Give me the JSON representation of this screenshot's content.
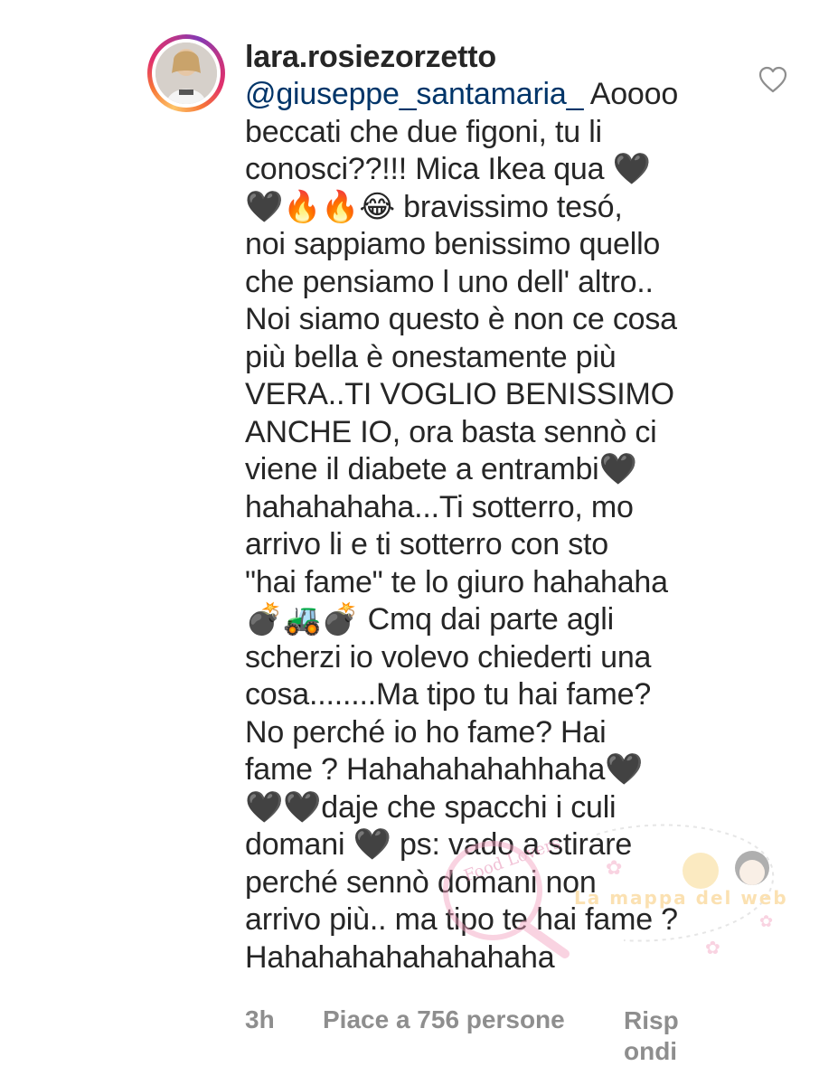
{
  "comment": {
    "username": "lara.rosiezorzetto",
    "mention": "@giuseppe_santamaria_",
    "lines": [
      " Aoooo",
      "beccati che due figoni, tu li",
      "conosci??!!! Mica Ikea qua 🖤",
      "🖤🔥🔥😂 bravissimo tesó,",
      "noi sappiamo benissimo quello",
      "che pensiamo l uno dell' altro..",
      "Noi siamo questo è non ce cosa",
      "più bella è onestamente più",
      "VERA..TI VOGLIO BENISSIMO",
      "ANCHE IO, ora basta sennò ci",
      "viene il diabete a entrambi🖤",
      "hahahahaha...Ti sotterro, mo",
      "arrivo li e ti sotterro con sto",
      "\"hai fame\" te lo giuro hahahaha",
      "💣🚜💣 Cmq dai parte agli",
      "scherzi io volevo chiederti una",
      "cosa........Ma tipo tu hai fame?",
      "No perché io ho fame? Hai",
      "fame ? Hahahahahahhaha🖤",
      "🖤🖤daje che spacchi i culi",
      "domani 🖤 ps: vado a stirare",
      "perché sennò domani non",
      "arrivo più.. ma tipo te hai fame ?",
      "Hahahahahahahahaha"
    ],
    "time": "3h",
    "likes": "Piace a 756 persone",
    "reply_line1": "Risp",
    "reply_line2": "ondi",
    "like_icon": "heart-outline-icon",
    "colors": {
      "text": "#262626",
      "mention": "#003569",
      "meta": "#8e8e8e"
    }
  },
  "watermark": {
    "text": "La mappa del web",
    "mark": "Food Lovers"
  }
}
